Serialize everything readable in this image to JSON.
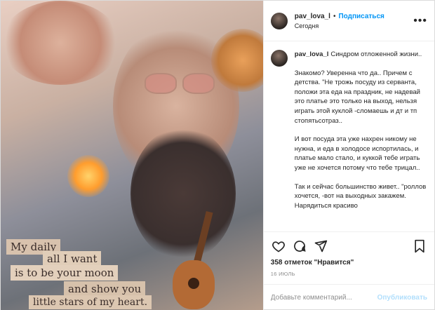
{
  "post": {
    "username": "pav_lova_l",
    "separator": "•",
    "follow_label": "Подписаться",
    "location": "Сегодня",
    "more_label": "•••"
  },
  "photo": {
    "collage_lines": [
      "My daily",
      "all I want",
      "is to be your moon",
      "and show you",
      "little stars of my heart."
    ]
  },
  "caption": {
    "username": "pav_lova_l",
    "first_line": "Синдром отложенной жизни..",
    "paragraphs": [
      "Знакомо? Уверенна что да.. Причем с детства. \"Не трожь посуду из серванта, положи эта еда на праздник, не надевай это платье это только на выход, нельзя играть этой куклой -сломаешь и дт и тп стопятьсотраз..",
      "И вот посуда эта уже нахрен никому не нужна, и еда в холодосе испортилась, и платье мало стало, и куккой тебе играть уже не хочется потому что тебе трицал..",
      "Так и сейчас большинство живет.. \"роллов хочется, -вот на выходных закажем. Нарядиться красиво"
    ]
  },
  "actions": {
    "likes_text": "358 отметок \"Нравится\"",
    "date_text": "16 ИЮЛЬ"
  },
  "comment": {
    "placeholder": "Добавьте комментарий...",
    "publish_label": "Опубликовать"
  }
}
